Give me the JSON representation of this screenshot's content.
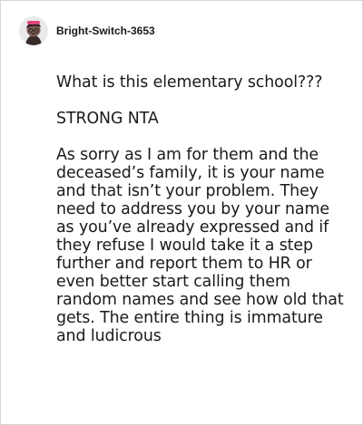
{
  "comment": {
    "username": "Bright-Switch-3653",
    "avatar_icon": "snoo-avatar-icon",
    "paragraphs": [
      "What is this elementary school???",
      "STRONG NTA",
      "As sorry as I am for them and the deceased’s family, it is your name and that isn’t your problem. They need to address you by your name as you’ve already expressed and if they refuse I would take it a step further and report them to HR or even better start calling them random names and see how old that gets. The entire thing is immature and ludicrous"
    ]
  },
  "colors": {
    "text": "#1a1a1b",
    "border": "#d6d6d6",
    "avatar_bg": "#e9e9ec",
    "avatar_accent": "#e0457b"
  }
}
